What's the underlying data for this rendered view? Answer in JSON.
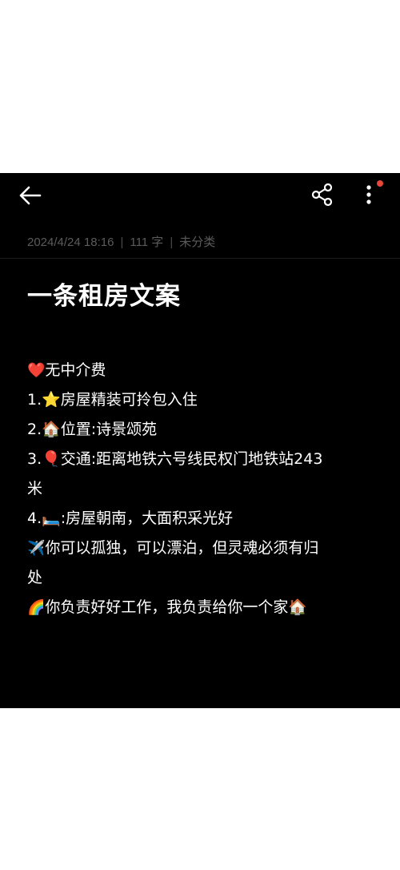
{
  "header": {
    "back_icon": "arrow-left-icon",
    "share_icon": "share-icon",
    "more_icon": "more-vertical-icon",
    "badge_color": "#e8473a"
  },
  "meta": {
    "datetime": "2024/4/24 18:16",
    "word_count": "111 字",
    "category": "未分类",
    "separator": "|"
  },
  "note": {
    "title": "一条租房文案",
    "lines": [
      {
        "emoji": "❤️",
        "text": "无中介费"
      },
      {
        "emoji": "",
        "text": "1.⭐房屋精装可拎包入住"
      },
      {
        "emoji": "",
        "text": "2.🏠位置:诗景颂苑"
      },
      {
        "emoji": "",
        "text": "3.🎈交通:距离地铁六号线民权门地铁站243"
      },
      {
        "emoji": "",
        "text": "米"
      },
      {
        "emoji": "",
        "text": "4.🛏️:房屋朝南，大面积采光好"
      },
      {
        "emoji": "✈️",
        "text": "你可以孤独，可以漂泊，但灵魂必须有归"
      },
      {
        "emoji": "",
        "text": "处"
      },
      {
        "emoji": "🌈",
        "text": "你负责好好工作，我负责给你一个家🏠"
      }
    ]
  }
}
